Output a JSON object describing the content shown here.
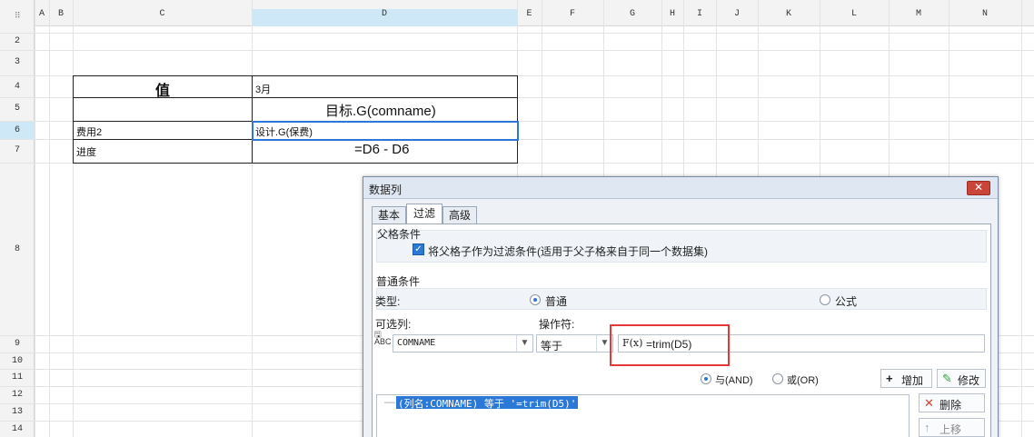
{
  "columns": [
    "A",
    "B",
    "C",
    "D",
    "E",
    "F",
    "G",
    "H",
    "I",
    "J",
    "K",
    "L",
    "M",
    "N"
  ],
  "rows": [
    "2",
    "3",
    "4",
    "5",
    "6",
    "7",
    "8",
    "9",
    "10",
    "11",
    "12",
    "13",
    "14"
  ],
  "cells": {
    "c4": "值",
    "d4": "3月",
    "d5": "目标.G(comname)",
    "c6": "费用2",
    "d6": "设计.G(保费)",
    "c7": "进度",
    "d7": "=D6 - D6"
  },
  "dialog": {
    "title": "数据列",
    "close_glyph": "✕",
    "tabs": [
      "基本",
      "过滤",
      "高级"
    ],
    "active_tab": "过滤",
    "parent": {
      "heading": "父格条件",
      "checkbox_label": "将父格子作为过滤条件(适用于父子格来自于同一个数据集)",
      "checked": true
    },
    "normal": {
      "heading": "普通条件",
      "type_label": "类型:",
      "option_normal": "普通",
      "option_formula": "公式",
      "selected": "普通",
      "column_label": "可选列:",
      "operator_label": "操作符:",
      "column_value": "COMNAME",
      "operator_value": "等于",
      "formula_value": "=trim(D5)",
      "and_label": "与(AND)",
      "or_label": "或(OR)",
      "add_button": "增加",
      "modify_button": "修改",
      "delete_button": "删除",
      "moveup_button": "上移",
      "condition_item": "(列名:COMNAME) 等于 '=trim(D5)'"
    }
  },
  "colors": {
    "accent": "#2b78d6",
    "highlight": "#e53935"
  }
}
